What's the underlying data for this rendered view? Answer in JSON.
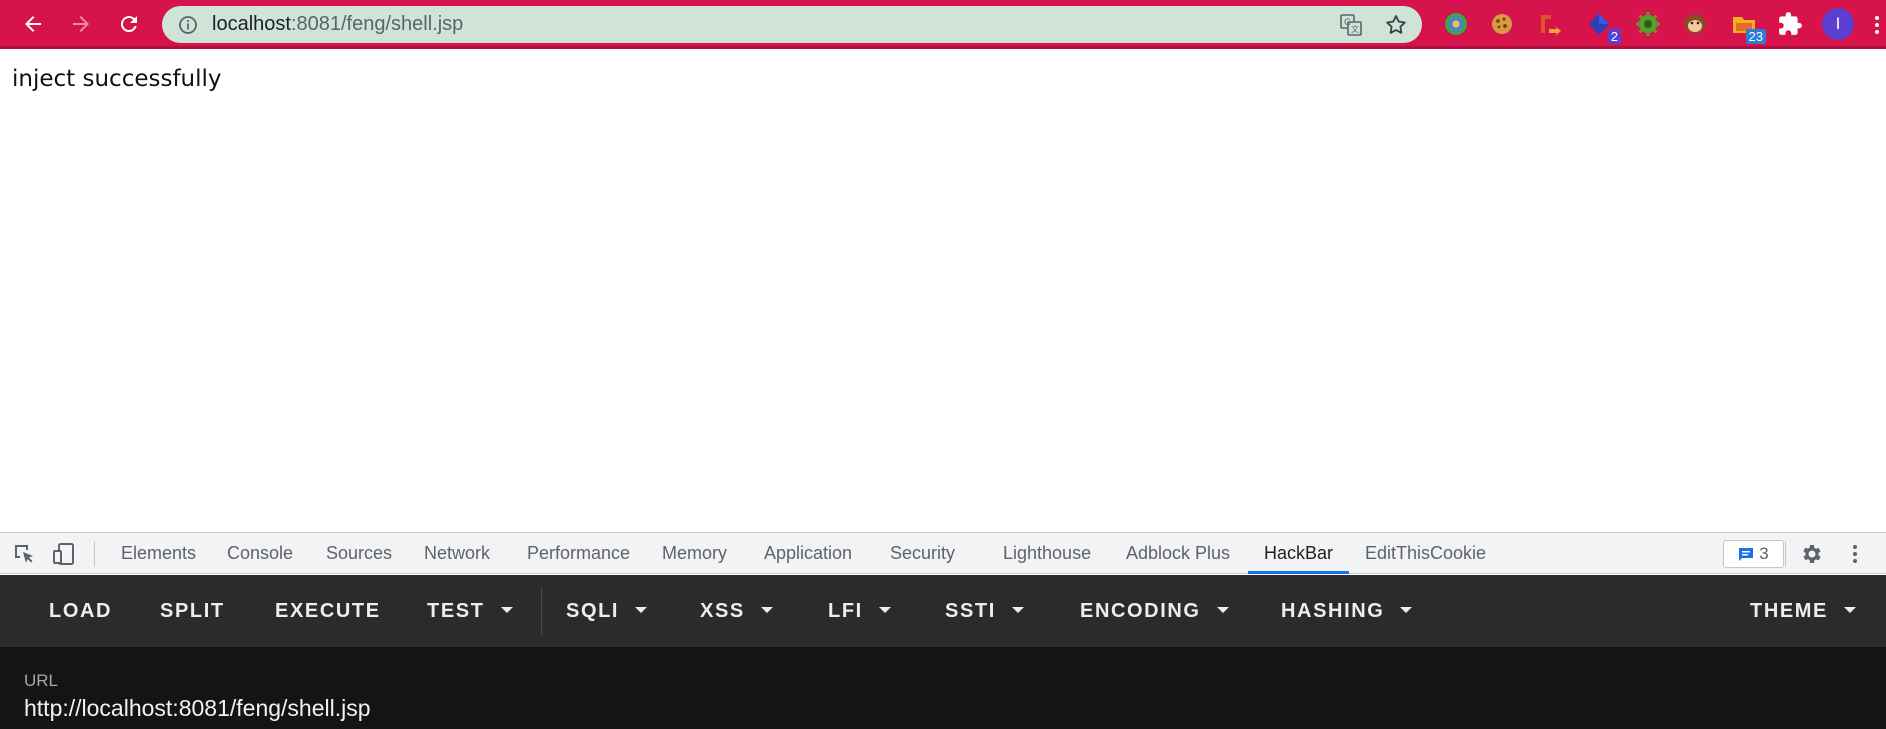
{
  "browser": {
    "url_host": "localhost",
    "url_rest": ":8081/feng/shell.jsp",
    "accent_color": "#d6134a",
    "extensions": [
      {
        "icon": "chrome-colorful-extension-icon",
        "badge": ""
      },
      {
        "icon": "cookie-icon",
        "badge": ""
      },
      {
        "icon": "arrow-extension-icon",
        "badge": ""
      },
      {
        "icon": "blue-diamond-extension-icon",
        "badge": "2"
      },
      {
        "icon": "green-gear-extension-icon",
        "badge": ""
      },
      {
        "icon": "monkey-icon",
        "badge": ""
      },
      {
        "icon": "folder-extension-icon",
        "badge": "23"
      },
      {
        "icon": "puzzle-icon",
        "badge": ""
      }
    ],
    "profile_initial": "I"
  },
  "page": {
    "text": "inject successfully"
  },
  "devtools": {
    "tabs": [
      "Elements",
      "Console",
      "Sources",
      "Network",
      "Performance",
      "Memory",
      "Application",
      "Security",
      "Lighthouse",
      "Adblock Plus",
      "HackBar",
      "EditThisCookie"
    ],
    "active_tab": "HackBar",
    "issues_count": "3"
  },
  "hackbar": {
    "buttons": [
      "LOAD",
      "SPLIT",
      "EXECUTE",
      "TEST",
      "SQLI",
      "XSS",
      "LFI",
      "SSTI",
      "ENCODING",
      "HASHING",
      "THEME"
    ],
    "url_label": "URL",
    "url_value": "http://localhost:8081/feng/shell.jsp"
  }
}
